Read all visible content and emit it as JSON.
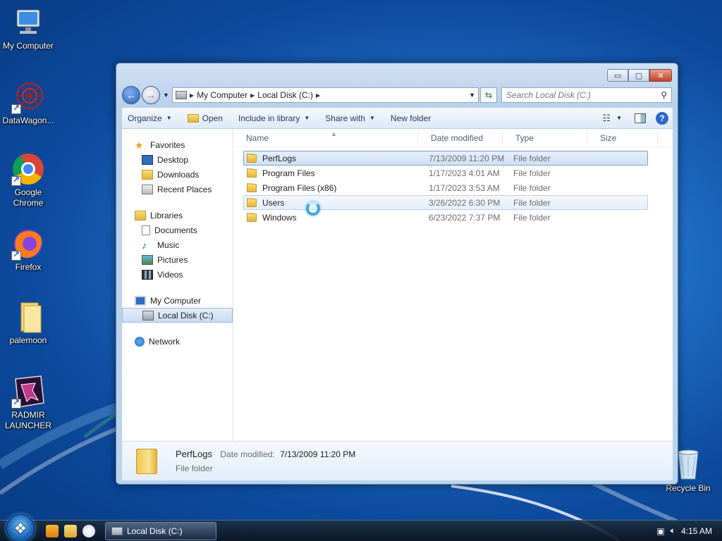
{
  "desktop": {
    "icons": [
      {
        "label": "My Computer"
      },
      {
        "label": "DataWagon..."
      },
      {
        "label": "Google Chrome"
      },
      {
        "label": "Firefox"
      },
      {
        "label": "palemoon"
      },
      {
        "label": "RADMIR LAUNCHER"
      },
      {
        "label": "Recycle Bin"
      }
    ]
  },
  "window": {
    "controls": {
      "minimize": "▭",
      "maximize": "▢",
      "close": "✕"
    },
    "address": {
      "crumbs": [
        "My Computer",
        "Local Disk (C:)"
      ]
    },
    "search": {
      "placeholder": "Search Local Disk (C:)"
    },
    "toolbar": {
      "organize": "Organize",
      "open": "Open",
      "include": "Include in library",
      "share": "Share with",
      "new_folder": "New folder",
      "help": "?"
    },
    "nav": {
      "favorites": {
        "label": "Favorites",
        "items": [
          "Desktop",
          "Downloads",
          "Recent Places"
        ]
      },
      "libraries": {
        "label": "Libraries",
        "items": [
          "Documents",
          "Music",
          "Pictures",
          "Videos"
        ]
      },
      "computer": {
        "label": "My Computer",
        "items": [
          "Local Disk (C:)"
        ]
      },
      "network": {
        "label": "Network"
      }
    },
    "columns": {
      "name": "Name",
      "date": "Date modified",
      "type": "Type",
      "size": "Size"
    },
    "files": [
      {
        "name": "PerfLogs",
        "date": "7/13/2009 11:20 PM",
        "type": "File folder"
      },
      {
        "name": "Program Files",
        "date": "1/17/2023 4:01 AM",
        "type": "File folder"
      },
      {
        "name": "Program Files (x86)",
        "date": "1/17/2023 3:53 AM",
        "type": "File folder"
      },
      {
        "name": "Users",
        "date": "3/26/2022 6:30 PM",
        "type": "File folder"
      },
      {
        "name": "Windows",
        "date": "6/23/2022 7:37 PM",
        "type": "File folder"
      }
    ],
    "details": {
      "name": "PerfLogs",
      "date_label": "Date modified:",
      "date_value": "7/13/2009 11:20 PM",
      "type": "File folder"
    }
  },
  "taskbar": {
    "task_label": "Local Disk (C:)",
    "clock": "4:15 AM"
  },
  "colors": {
    "accent": "#2b68c8",
    "selection": "#cfe1f6"
  }
}
